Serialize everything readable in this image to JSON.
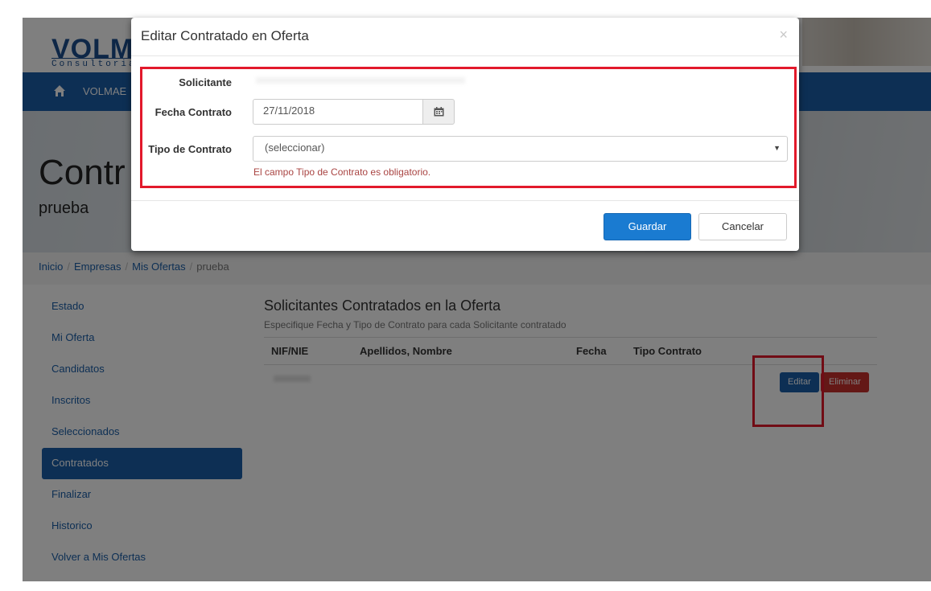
{
  "header": {
    "logo_main": "VOLM",
    "logo_sub": "Consultoria"
  },
  "navbar": {
    "home_icon": "home-icon",
    "item": "VOLMAE"
  },
  "hero": {
    "title": "Contr",
    "subtitle": "prueba"
  },
  "breadcrumb": {
    "items": [
      "Inicio",
      "Empresas",
      "Mis Ofertas"
    ],
    "active": "prueba"
  },
  "sidebar": {
    "items": [
      {
        "label": "Estado"
      },
      {
        "label": "Mi Oferta"
      },
      {
        "label": "Candidatos"
      },
      {
        "label": "Inscritos"
      },
      {
        "label": "Seleccionados"
      },
      {
        "label": "Contratados",
        "active": true
      },
      {
        "label": "Finalizar"
      },
      {
        "label": "Historico"
      },
      {
        "label": "Volver a Mis Ofertas"
      }
    ]
  },
  "content": {
    "title": "Solicitantes Contratados en la Oferta",
    "subtitle": "Especifique Fecha y Tipo de Contrato para cada Solicitante contratado",
    "columns": [
      "NIF/NIE",
      "Apellidos, Nombre",
      "Fecha",
      "Tipo Contrato"
    ],
    "row_actions": {
      "edit": "Editar",
      "delete": "Eliminar"
    }
  },
  "modal": {
    "title": "Editar Contratado en Oferta",
    "close": "×",
    "solicitante_label": "Solicitante",
    "fecha_label": "Fecha Contrato",
    "fecha_value": "27/11/2018",
    "tipo_label": "Tipo de Contrato",
    "tipo_value": "(seleccionar)",
    "error": "El campo Tipo de Contrato es obligatorio.",
    "save": "Guardar",
    "cancel": "Cancelar"
  },
  "colors": {
    "primary": "#1a5ea8",
    "save_button": "#1a7bd1",
    "danger": "#c9302c",
    "highlight_frame": "#e2192b",
    "error_text": "#a94442"
  }
}
